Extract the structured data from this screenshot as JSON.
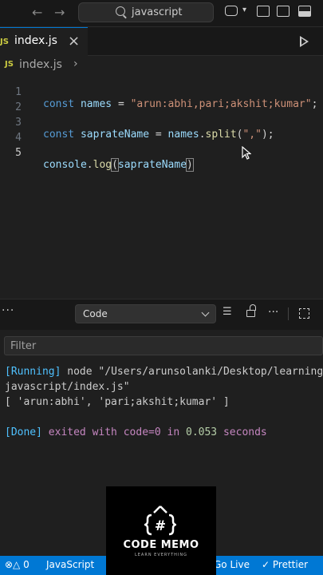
{
  "search": {
    "text": "javascript"
  },
  "tabs": [
    {
      "badge": "JS",
      "label": "index.js"
    }
  ],
  "breadcrumb": {
    "badge": "JS",
    "file": "index.js",
    "sep": "›"
  },
  "editor": {
    "lines": [
      {
        "num": "1"
      },
      {
        "num": "2"
      },
      {
        "num": "3"
      },
      {
        "num": "4"
      },
      {
        "num": "5"
      }
    ],
    "tokens": {
      "const": "const",
      "names": "names",
      "eq": "=",
      "names_str": "\"arun:abhi,pari;akshit;kumar\"",
      "semi": ";",
      "saprateName": "saprateName",
      "dot": ".",
      "split": "split",
      "open": "(",
      "comma_str": "\",\"",
      "close": ")",
      "console": "console",
      "log": "log"
    }
  },
  "panel": {
    "more": "···",
    "select_label": "Code",
    "filter_placeholder": "Filter"
  },
  "output": {
    "running_tag": "[Running]",
    "running_cmd": " node \"/Users/arunsolanki/Desktop/learning/",
    "running_cmd2": "javascript/index.js\"",
    "result": "[ 'arun:abhi', 'pari;akshit;kumar' ]",
    "done_tag": "[Done]",
    "done_text1": " exited with ",
    "done_code": "code=0",
    "done_text2": " in ",
    "done_time": "0.053",
    "done_text3": " seconds"
  },
  "watermark": {
    "title": "CODE MEMO",
    "subtitle": "LEARN EVERYTHING"
  },
  "statusbar": {
    "problems": "0",
    "language": "JavaScript",
    "golive": "Go Live",
    "prettier": "Prettier"
  },
  "colors": {
    "accent": "#0078d4",
    "js_badge": "#cbcb41"
  }
}
